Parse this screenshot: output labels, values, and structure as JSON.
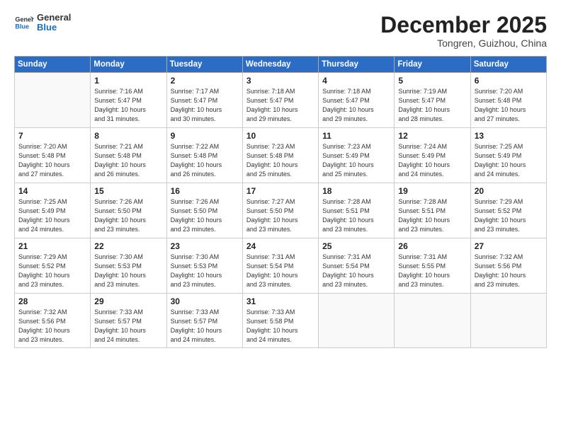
{
  "header": {
    "logo_general": "General",
    "logo_blue": "Blue",
    "month_title": "December 2025",
    "location": "Tongren, Guizhou, China"
  },
  "weekdays": [
    "Sunday",
    "Monday",
    "Tuesday",
    "Wednesday",
    "Thursday",
    "Friday",
    "Saturday"
  ],
  "weeks": [
    [
      {
        "day": "",
        "info": ""
      },
      {
        "day": "1",
        "info": "Sunrise: 7:16 AM\nSunset: 5:47 PM\nDaylight: 10 hours\nand 31 minutes."
      },
      {
        "day": "2",
        "info": "Sunrise: 7:17 AM\nSunset: 5:47 PM\nDaylight: 10 hours\nand 30 minutes."
      },
      {
        "day": "3",
        "info": "Sunrise: 7:18 AM\nSunset: 5:47 PM\nDaylight: 10 hours\nand 29 minutes."
      },
      {
        "day": "4",
        "info": "Sunrise: 7:18 AM\nSunset: 5:47 PM\nDaylight: 10 hours\nand 29 minutes."
      },
      {
        "day": "5",
        "info": "Sunrise: 7:19 AM\nSunset: 5:47 PM\nDaylight: 10 hours\nand 28 minutes."
      },
      {
        "day": "6",
        "info": "Sunrise: 7:20 AM\nSunset: 5:48 PM\nDaylight: 10 hours\nand 27 minutes."
      }
    ],
    [
      {
        "day": "7",
        "info": "Sunrise: 7:20 AM\nSunset: 5:48 PM\nDaylight: 10 hours\nand 27 minutes."
      },
      {
        "day": "8",
        "info": "Sunrise: 7:21 AM\nSunset: 5:48 PM\nDaylight: 10 hours\nand 26 minutes."
      },
      {
        "day": "9",
        "info": "Sunrise: 7:22 AM\nSunset: 5:48 PM\nDaylight: 10 hours\nand 26 minutes."
      },
      {
        "day": "10",
        "info": "Sunrise: 7:23 AM\nSunset: 5:48 PM\nDaylight: 10 hours\nand 25 minutes."
      },
      {
        "day": "11",
        "info": "Sunrise: 7:23 AM\nSunset: 5:49 PM\nDaylight: 10 hours\nand 25 minutes."
      },
      {
        "day": "12",
        "info": "Sunrise: 7:24 AM\nSunset: 5:49 PM\nDaylight: 10 hours\nand 24 minutes."
      },
      {
        "day": "13",
        "info": "Sunrise: 7:25 AM\nSunset: 5:49 PM\nDaylight: 10 hours\nand 24 minutes."
      }
    ],
    [
      {
        "day": "14",
        "info": "Sunrise: 7:25 AM\nSunset: 5:49 PM\nDaylight: 10 hours\nand 24 minutes."
      },
      {
        "day": "15",
        "info": "Sunrise: 7:26 AM\nSunset: 5:50 PM\nDaylight: 10 hours\nand 23 minutes."
      },
      {
        "day": "16",
        "info": "Sunrise: 7:26 AM\nSunset: 5:50 PM\nDaylight: 10 hours\nand 23 minutes."
      },
      {
        "day": "17",
        "info": "Sunrise: 7:27 AM\nSunset: 5:50 PM\nDaylight: 10 hours\nand 23 minutes."
      },
      {
        "day": "18",
        "info": "Sunrise: 7:28 AM\nSunset: 5:51 PM\nDaylight: 10 hours\nand 23 minutes."
      },
      {
        "day": "19",
        "info": "Sunrise: 7:28 AM\nSunset: 5:51 PM\nDaylight: 10 hours\nand 23 minutes."
      },
      {
        "day": "20",
        "info": "Sunrise: 7:29 AM\nSunset: 5:52 PM\nDaylight: 10 hours\nand 23 minutes."
      }
    ],
    [
      {
        "day": "21",
        "info": "Sunrise: 7:29 AM\nSunset: 5:52 PM\nDaylight: 10 hours\nand 23 minutes."
      },
      {
        "day": "22",
        "info": "Sunrise: 7:30 AM\nSunset: 5:53 PM\nDaylight: 10 hours\nand 23 minutes."
      },
      {
        "day": "23",
        "info": "Sunrise: 7:30 AM\nSunset: 5:53 PM\nDaylight: 10 hours\nand 23 minutes."
      },
      {
        "day": "24",
        "info": "Sunrise: 7:31 AM\nSunset: 5:54 PM\nDaylight: 10 hours\nand 23 minutes."
      },
      {
        "day": "25",
        "info": "Sunrise: 7:31 AM\nSunset: 5:54 PM\nDaylight: 10 hours\nand 23 minutes."
      },
      {
        "day": "26",
        "info": "Sunrise: 7:31 AM\nSunset: 5:55 PM\nDaylight: 10 hours\nand 23 minutes."
      },
      {
        "day": "27",
        "info": "Sunrise: 7:32 AM\nSunset: 5:56 PM\nDaylight: 10 hours\nand 23 minutes."
      }
    ],
    [
      {
        "day": "28",
        "info": "Sunrise: 7:32 AM\nSunset: 5:56 PM\nDaylight: 10 hours\nand 23 minutes."
      },
      {
        "day": "29",
        "info": "Sunrise: 7:33 AM\nSunset: 5:57 PM\nDaylight: 10 hours\nand 24 minutes."
      },
      {
        "day": "30",
        "info": "Sunrise: 7:33 AM\nSunset: 5:57 PM\nDaylight: 10 hours\nand 24 minutes."
      },
      {
        "day": "31",
        "info": "Sunrise: 7:33 AM\nSunset: 5:58 PM\nDaylight: 10 hours\nand 24 minutes."
      },
      {
        "day": "",
        "info": ""
      },
      {
        "day": "",
        "info": ""
      },
      {
        "day": "",
        "info": ""
      }
    ]
  ]
}
